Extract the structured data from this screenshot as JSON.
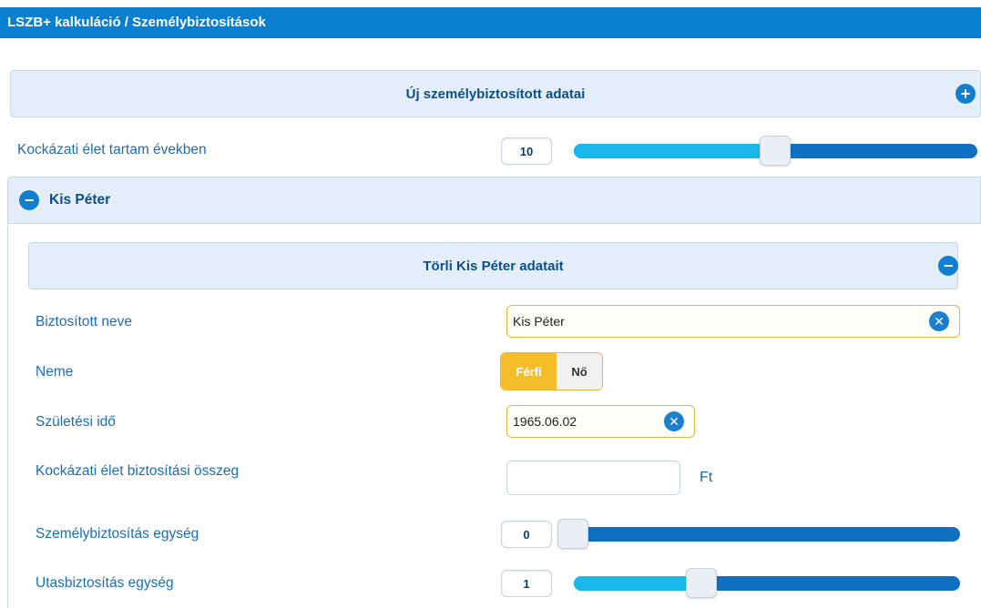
{
  "titlebar": {
    "title": "LSZB+ kalkuláció / Személybiztosítások"
  },
  "new_insured": {
    "label": "Új személybiztosított adatai",
    "icon": "plus-circle-icon"
  },
  "risk_term": {
    "label": "Kockázati élet tartam években",
    "value": "10",
    "slider_fraction": 0.5
  },
  "person": {
    "name": "Kis Péter",
    "collapse_icon": "minus-circle-icon",
    "delete_label": "Törli Kis Péter adatait",
    "delete_icon": "minus-circle-icon",
    "fields": {
      "name_label": "Biztosított neve",
      "name_value": "Kis Péter",
      "gender_label": "Neme",
      "gender_male": "Férfi",
      "gender_female": "Nő",
      "gender_selected": "Férfi",
      "birth_label": "Születési idő",
      "birth_value": "1965.06.02",
      "sum_label": "Kockázati élet biztosítási összeg",
      "sum_value": "",
      "sum_unit": "Ft",
      "personal_units_label": "Személybiztosítás egység",
      "personal_units_value": "0",
      "personal_units_fraction": 0.0,
      "travel_units_label": "Utasbiztosítás egység",
      "travel_units_value": "1",
      "travel_units_fraction": 0.33
    }
  },
  "colors": {
    "brand_blue": "#0a7fd0",
    "slider_fill": "#1ab7ea",
    "slider_track": "#0f6fc0",
    "selected_gold": "#f6bd2b",
    "label_blue": "#1a6db5"
  }
}
